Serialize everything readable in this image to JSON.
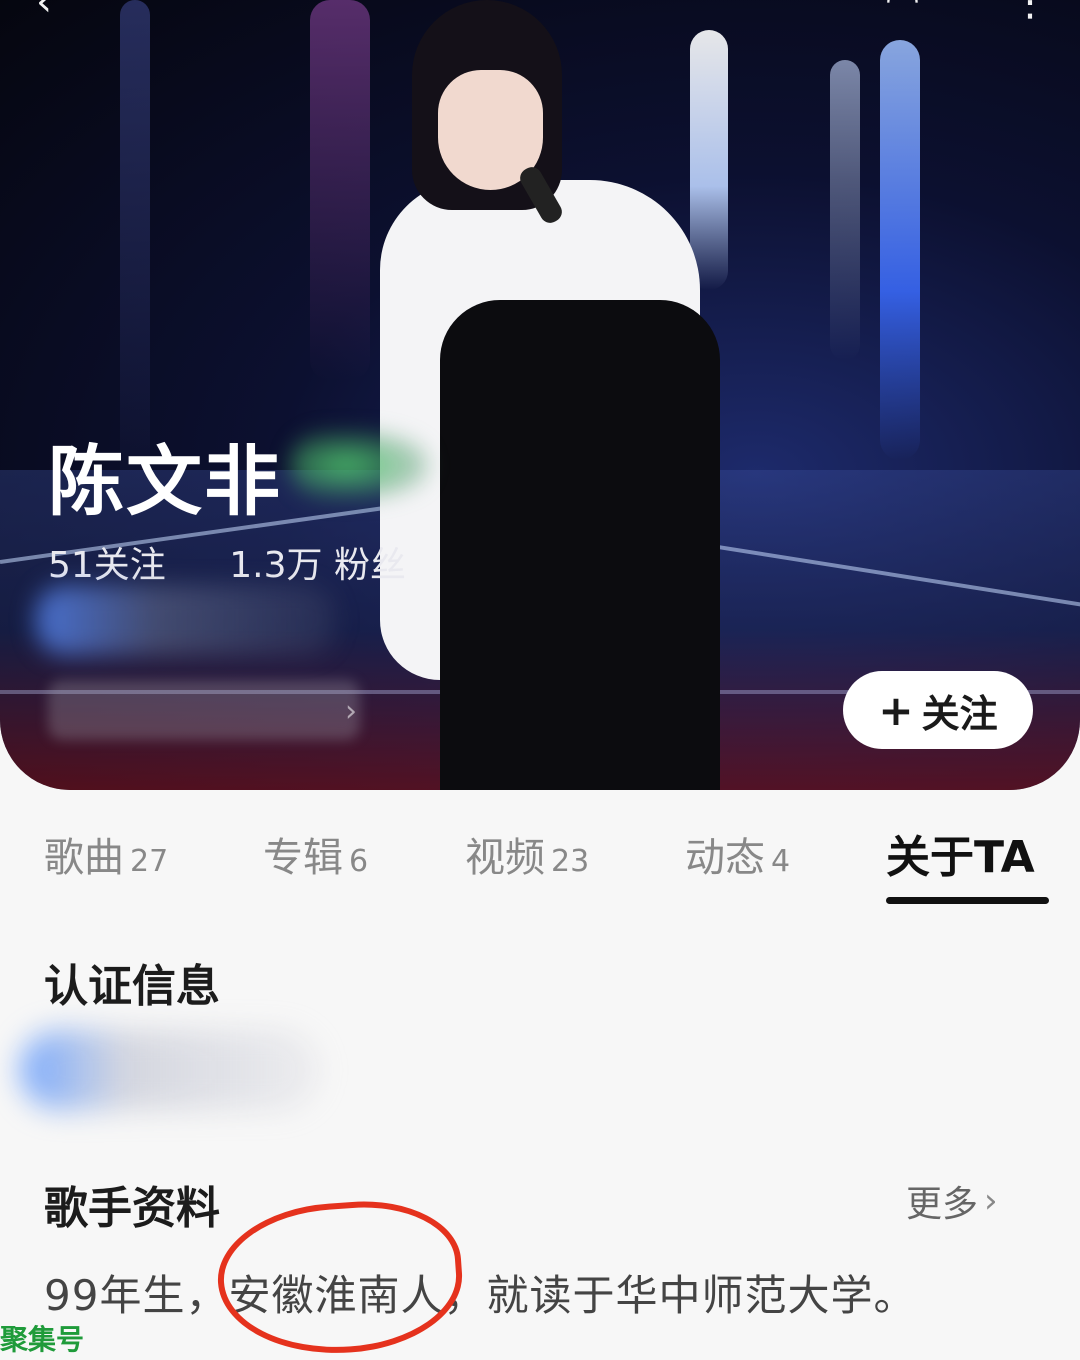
{
  "hero": {
    "artist_name": "陈文非",
    "following": "51关注",
    "fans": "1.3万 粉丝",
    "follow_label": "关注"
  },
  "tabs": [
    {
      "label": "歌曲",
      "count": "27"
    },
    {
      "label": "专辑",
      "count": "6"
    },
    {
      "label": "视频",
      "count": "23"
    },
    {
      "label": "动态",
      "count": "4"
    },
    {
      "label": "关于TA",
      "count": ""
    }
  ],
  "sections": {
    "cert_title": "认证信息",
    "profile_title": "歌手资料",
    "more_label": "更多",
    "bio": "99年生，安徽淮南人，就读于华中师范大学。"
  },
  "watermark": "聚集号",
  "colors": {
    "accent": "#111111",
    "annotation": "#e5321d",
    "watermark": "#1f9b3a"
  }
}
